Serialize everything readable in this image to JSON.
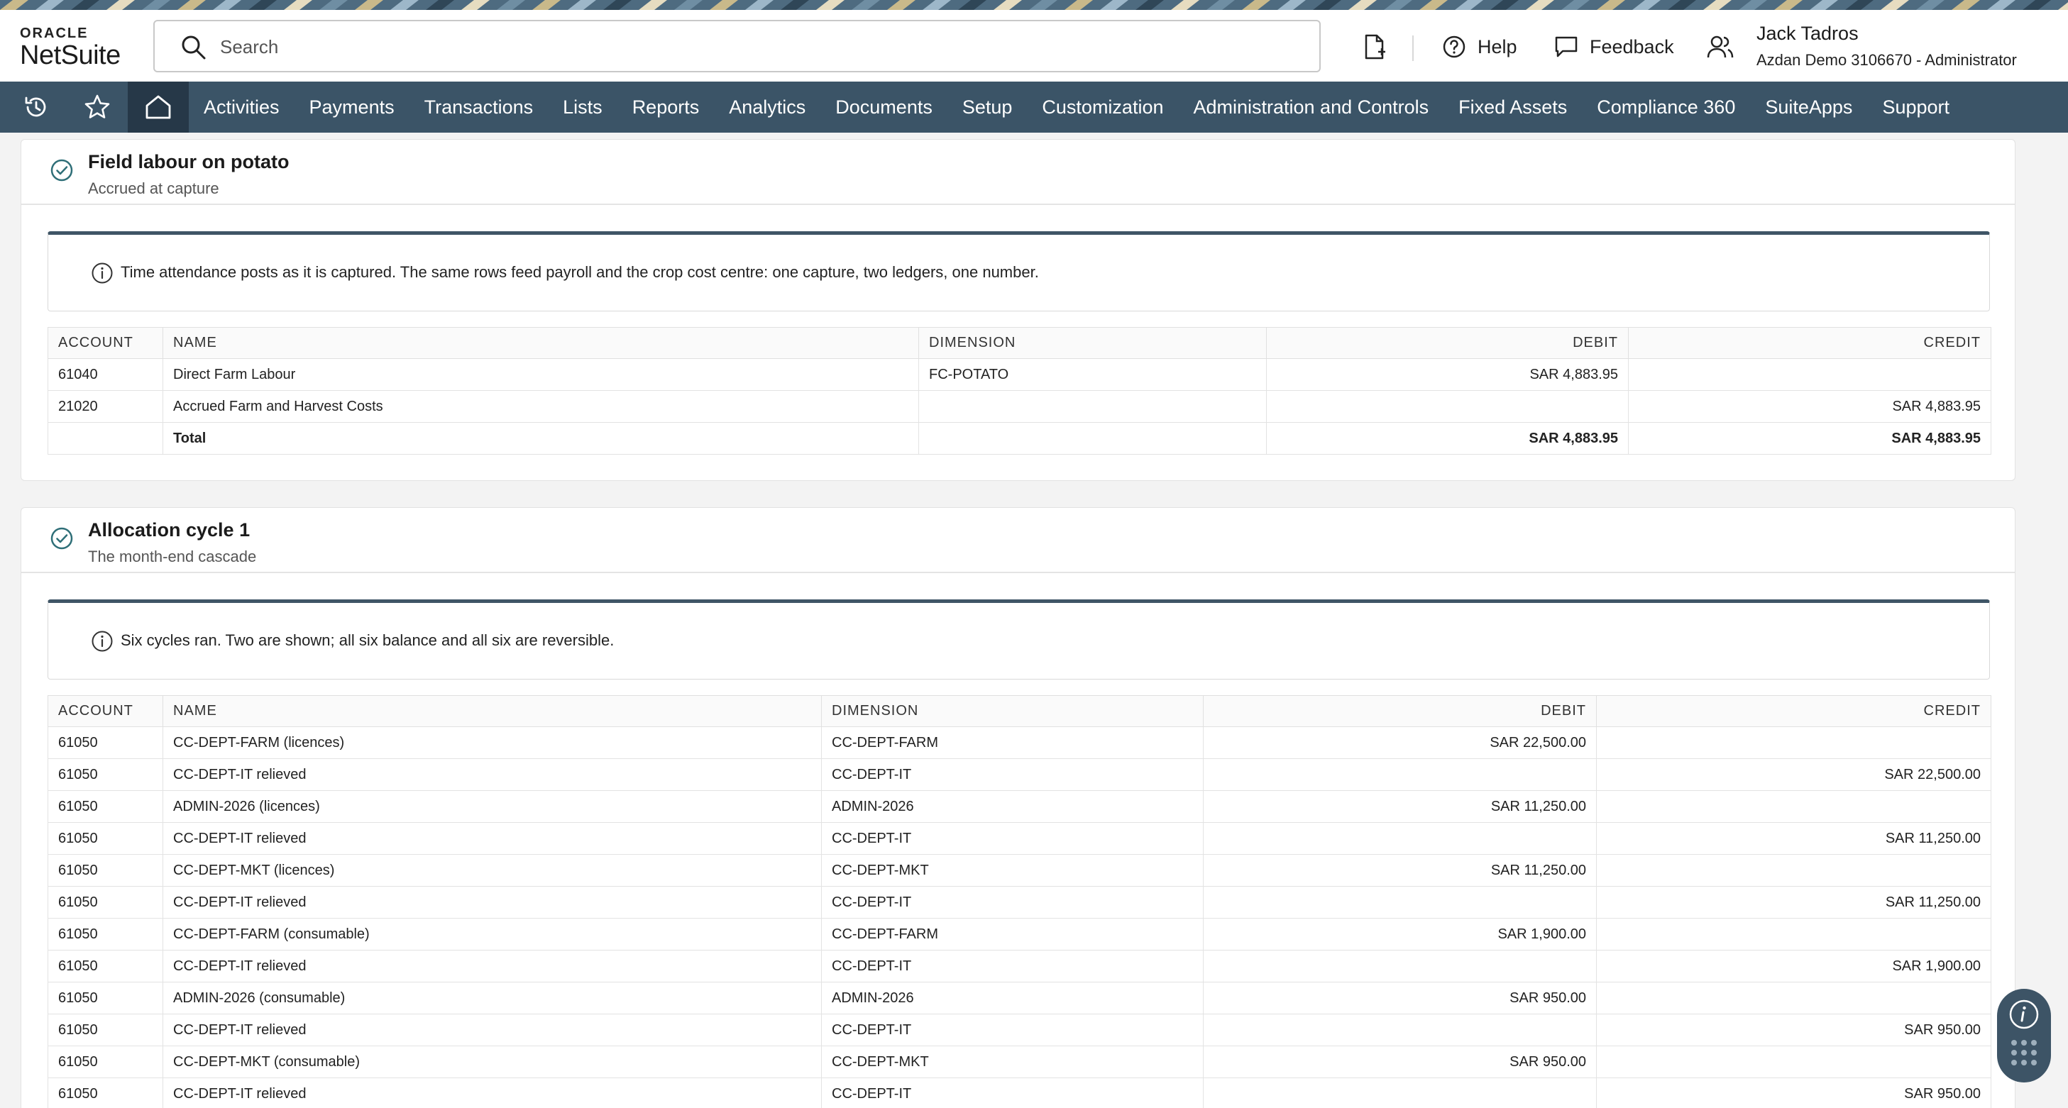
{
  "header": {
    "logo_top": "ORACLE",
    "logo_bottom": "NetSuite",
    "search_placeholder": "Search",
    "help_label": "Help",
    "feedback_label": "Feedback",
    "user_name": "Jack Tadros",
    "user_account": "Azdan Demo 3106670 - Administrator"
  },
  "nav": {
    "items": [
      "Activities",
      "Payments",
      "Transactions",
      "Lists",
      "Reports",
      "Analytics",
      "Documents",
      "Setup",
      "Customization",
      "Administration and Controls",
      "Fixed Assets",
      "Compliance 360",
      "SuiteApps",
      "Support"
    ]
  },
  "columns": [
    "ACCOUNT",
    "NAME",
    "DIMENSION",
    "DEBIT",
    "CREDIT"
  ],
  "section1": {
    "title": "Field labour on potato",
    "subtitle": "Accrued at capture",
    "info": "Time attendance posts as it is captured. The same rows feed payroll and the crop cost centre: one capture, two ledgers, one number.",
    "rows": [
      {
        "account": "61040",
        "name": "Direct Farm Labour",
        "dimension": "FC-POTATO",
        "debit": "SAR 4,883.95",
        "credit": ""
      },
      {
        "account": "21020",
        "name": "Accrued Farm and Harvest Costs",
        "dimension": "",
        "debit": "",
        "credit": "SAR 4,883.95"
      }
    ],
    "total": {
      "label": "Total",
      "debit": "SAR 4,883.95",
      "credit": "SAR 4,883.95"
    }
  },
  "section2": {
    "title": "Allocation cycle 1",
    "subtitle": "The month-end cascade",
    "info": "Six cycles ran. Two are shown; all six balance and all six are reversible.",
    "rows": [
      {
        "account": "61050",
        "name": "CC-DEPT-FARM (licences)",
        "dimension": "CC-DEPT-FARM",
        "debit": "SAR 22,500.00",
        "credit": ""
      },
      {
        "account": "61050",
        "name": "CC-DEPT-IT relieved",
        "dimension": "CC-DEPT-IT",
        "debit": "",
        "credit": "SAR 22,500.00"
      },
      {
        "account": "61050",
        "name": "ADMIN-2026 (licences)",
        "dimension": "ADMIN-2026",
        "debit": "SAR 11,250.00",
        "credit": ""
      },
      {
        "account": "61050",
        "name": "CC-DEPT-IT relieved",
        "dimension": "CC-DEPT-IT",
        "debit": "",
        "credit": "SAR 11,250.00"
      },
      {
        "account": "61050",
        "name": "CC-DEPT-MKT (licences)",
        "dimension": "CC-DEPT-MKT",
        "debit": "SAR 11,250.00",
        "credit": ""
      },
      {
        "account": "61050",
        "name": "CC-DEPT-IT relieved",
        "dimension": "CC-DEPT-IT",
        "debit": "",
        "credit": "SAR 11,250.00"
      },
      {
        "account": "61050",
        "name": "CC-DEPT-FARM (consumable)",
        "dimension": "CC-DEPT-FARM",
        "debit": "SAR 1,900.00",
        "credit": ""
      },
      {
        "account": "61050",
        "name": "CC-DEPT-IT relieved",
        "dimension": "CC-DEPT-IT",
        "debit": "",
        "credit": "SAR 1,900.00"
      },
      {
        "account": "61050",
        "name": "ADMIN-2026 (consumable)",
        "dimension": "ADMIN-2026",
        "debit": "SAR 950.00",
        "credit": ""
      },
      {
        "account": "61050",
        "name": "CC-DEPT-IT relieved",
        "dimension": "CC-DEPT-IT",
        "debit": "",
        "credit": "SAR 950.00"
      },
      {
        "account": "61050",
        "name": "CC-DEPT-MKT (consumable)",
        "dimension": "CC-DEPT-MKT",
        "debit": "SAR 950.00",
        "credit": ""
      },
      {
        "account": "61050",
        "name": "CC-DEPT-IT relieved",
        "dimension": "CC-DEPT-IT",
        "debit": "",
        "credit": "SAR 950.00"
      }
    ]
  },
  "colors": {
    "navbar": "#3b5467",
    "nav_active": "#263848",
    "accent": "#2f6f78"
  }
}
